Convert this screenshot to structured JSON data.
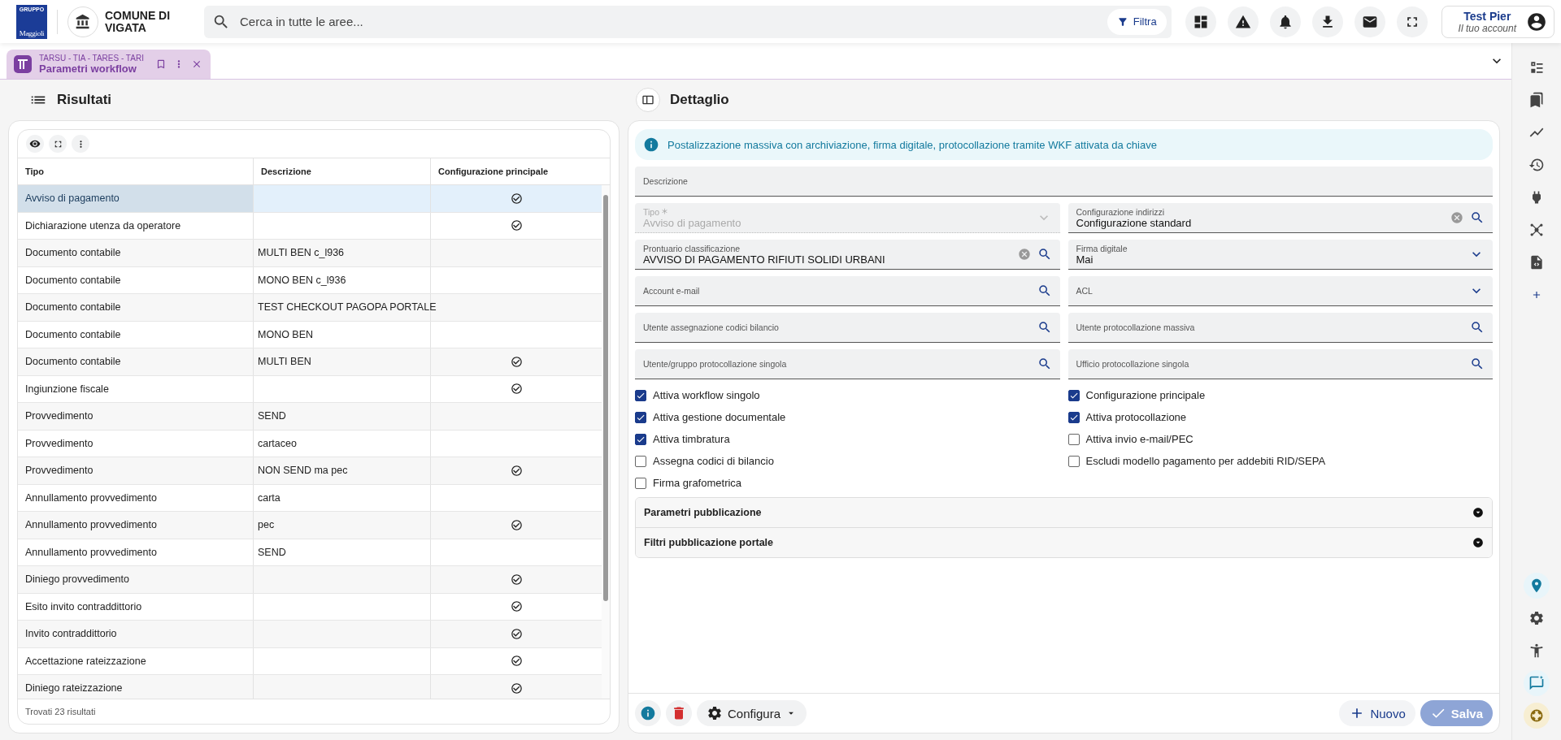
{
  "header": {
    "logo": {
      "group": "GRUPPO",
      "name": "Maggioli"
    },
    "organization": "COMUNE DI VIGATA",
    "search": {
      "placeholder": "Cerca in tutte le aree..."
    },
    "filter_button": "Filtra",
    "account": {
      "name": "Test Pier",
      "subtitle": "Il tuo account"
    }
  },
  "tabs": [
    {
      "module": "TARSU - TIA - TARES - TARI",
      "title": "Parametri workflow",
      "selected": true
    }
  ],
  "results": {
    "title": "Risultati",
    "columns": [
      "Tipo",
      "Descrizione",
      "Configurazione principale"
    ],
    "rows": [
      {
        "tipo": "Avviso di pagamento",
        "descrizione": "",
        "principale": true,
        "selected": true
      },
      {
        "tipo": "Dichiarazione utenza da operatore",
        "descrizione": "",
        "principale": true,
        "selected": false
      },
      {
        "tipo": "Documento contabile",
        "descrizione": "MULTI BEN c_l936",
        "principale": false,
        "selected": false
      },
      {
        "tipo": "Documento contabile",
        "descrizione": "MONO BEN c_l936",
        "principale": false,
        "selected": false
      },
      {
        "tipo": "Documento contabile",
        "descrizione": "TEST CHECKOUT PAGOPA PORTALE",
        "principale": false,
        "selected": false
      },
      {
        "tipo": "Documento contabile",
        "descrizione": "MONO BEN",
        "principale": false,
        "selected": false
      },
      {
        "tipo": "Documento contabile",
        "descrizione": "MULTI BEN",
        "principale": true,
        "selected": false
      },
      {
        "tipo": "Ingiunzione fiscale",
        "descrizione": "",
        "principale": true,
        "selected": false
      },
      {
        "tipo": "Provvedimento",
        "descrizione": "SEND",
        "principale": false,
        "selected": false
      },
      {
        "tipo": "Provvedimento",
        "descrizione": "cartaceo",
        "principale": false,
        "selected": false
      },
      {
        "tipo": "Provvedimento",
        "descrizione": "NON SEND ma pec",
        "principale": true,
        "selected": false
      },
      {
        "tipo": "Annullamento provvedimento",
        "descrizione": "carta",
        "principale": false,
        "selected": false
      },
      {
        "tipo": "Annullamento provvedimento",
        "descrizione": "pec",
        "principale": true,
        "selected": false
      },
      {
        "tipo": "Annullamento provvedimento",
        "descrizione": "SEND",
        "principale": false,
        "selected": false
      },
      {
        "tipo": "Diniego provvedimento",
        "descrizione": "",
        "principale": true,
        "selected": false
      },
      {
        "tipo": "Esito invito contraddittorio",
        "descrizione": "",
        "principale": true,
        "selected": false
      },
      {
        "tipo": "Invito contraddittorio",
        "descrizione": "",
        "principale": true,
        "selected": false
      },
      {
        "tipo": "Accettazione rateizzazione",
        "descrizione": "",
        "principale": true,
        "selected": false
      },
      {
        "tipo": "Diniego rateizzazione",
        "descrizione": "",
        "principale": true,
        "selected": false
      }
    ],
    "footer": "Trovati 23 risultati"
  },
  "detail": {
    "title": "Dettaglio",
    "info": "Postalizzazione massiva con archiviazione, firma digitale, protocollazione tramite WKF attivata da chiave",
    "description_field": {
      "label": "Descrizione"
    },
    "fields": [
      {
        "label": "Tipo",
        "value": "Avviso di pagamento",
        "kind": "select",
        "disabled": true,
        "required": true,
        "clearable": false
      },
      {
        "label": "Configurazione indirizzi",
        "value": "Configurazione standard",
        "kind": "lookup",
        "disabled": false,
        "required": false,
        "clearable": true
      },
      {
        "label": "Prontuario classificazione",
        "value": "AVVISO DI PAGAMENTO RIFIUTI SOLIDI URBANI",
        "kind": "lookup",
        "disabled": false,
        "required": false,
        "clearable": true
      },
      {
        "label": "Firma digitale",
        "value": "Mai",
        "kind": "select",
        "disabled": false,
        "required": false,
        "clearable": false
      },
      {
        "label": "Account e-mail",
        "kind": "lookup",
        "disabled": false,
        "required": false,
        "clearable": false
      },
      {
        "label": "ACL",
        "kind": "select",
        "disabled": false,
        "required": false,
        "clearable": false
      },
      {
        "label": "Utente assegnazione codici bilancio",
        "kind": "lookup",
        "disabled": false,
        "required": false,
        "clearable": false
      },
      {
        "label": "Utente protocollazione massiva",
        "kind": "lookup",
        "disabled": false,
        "required": false,
        "clearable": false
      },
      {
        "label": "Utente/gruppo protocollazione singola",
        "kind": "lookup",
        "disabled": false,
        "required": false,
        "clearable": false
      },
      {
        "label": "Ufficio protocollazione singola",
        "kind": "lookup",
        "disabled": false,
        "required": false,
        "clearable": false
      }
    ],
    "checkbox_columns": [
      [
        {
          "label": "Attiva workflow singolo",
          "checked": true
        },
        {
          "label": "Attiva gestione documentale",
          "checked": true
        },
        {
          "label": "Attiva timbratura",
          "checked": true
        },
        {
          "label": "Assegna codici di bilancio",
          "checked": false
        },
        {
          "label": "Firma grafometrica",
          "checked": false
        }
      ],
      [
        {
          "label": "Configurazione principale",
          "checked": true
        },
        {
          "label": "Attiva protocollazione",
          "checked": true
        },
        {
          "label": "Attiva invio e-mail/PEC",
          "checked": false
        },
        {
          "label": "Escludi modello pagamento per addebiti RID/SEPA",
          "checked": false
        }
      ]
    ],
    "sections": [
      {
        "title": "Parametri pubblicazione",
        "expanded": false
      },
      {
        "title": "Filtri pubblicazione portale",
        "expanded": false
      }
    ],
    "buttons": {
      "configure": "Configura",
      "new": "Nuovo",
      "save": {
        "label": "Salva",
        "disabled": true
      }
    }
  }
}
